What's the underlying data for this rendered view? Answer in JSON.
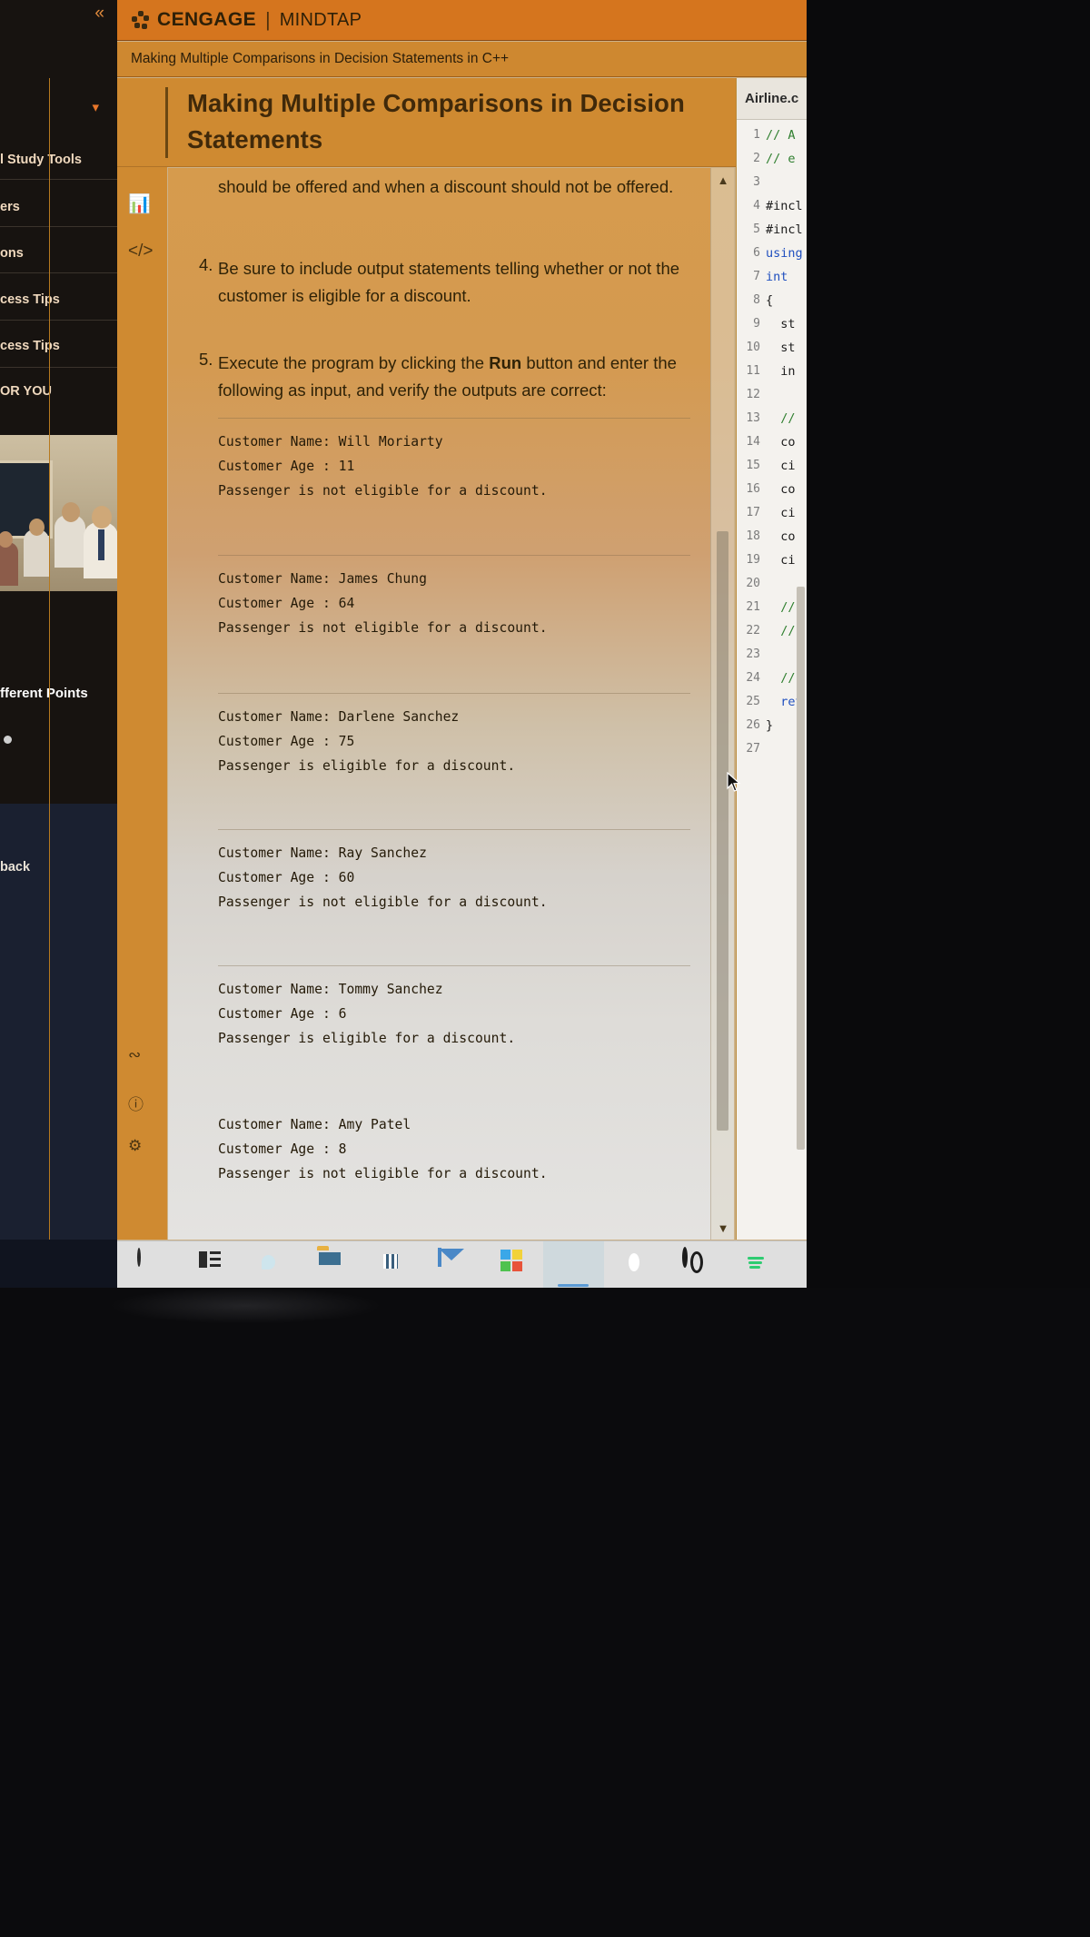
{
  "header": {
    "brand": "CENGAGE",
    "divider": "|",
    "product": "MINDTAP",
    "logo_icon": "cengage-leaf-icon"
  },
  "breadcrumb": {
    "text": "Making Multiple Comparisons in Decision Statements in C++"
  },
  "activity": {
    "book_icon": "open-book-icon",
    "title": "Making Multiple Comparisons in Decision Statements"
  },
  "icon_rail": [
    {
      "name": "open-book-icon",
      "glyph": "☷"
    },
    {
      "name": "checklist-icon",
      "glyph": "≣"
    },
    {
      "name": "bar-chart-icon",
      "glyph": "█"
    },
    {
      "name": "code-brackets-icon",
      "glyph": "</>"
    },
    {
      "name": "share-icon",
      "glyph": "∴"
    },
    {
      "name": "help-circle-icon",
      "glyph": "?"
    },
    {
      "name": "settings-gear-icon",
      "glyph": "⚙"
    }
  ],
  "sidebar": {
    "collapse_icon": "double-chevron-left-icon",
    "chevron_icon": "chevron-down-icon",
    "items": [
      {
        "label": "l Study Tools"
      },
      {
        "label": "ers"
      },
      {
        "label": "ons"
      },
      {
        "label": "cess Tips"
      },
      {
        "label": "cess Tips"
      },
      {
        "label": "OR YOU"
      }
    ],
    "promo_caption": "fferent Points",
    "back_label": "back"
  },
  "lesson": {
    "para_3_tail": "should be offered and when a discount should not be offered.",
    "items": [
      {
        "num": "4.",
        "text": "Be sure to include output statements telling whether or not the customer is eligible for a discount."
      },
      {
        "num": "5.",
        "text_before": "Execute the program by clicking the ",
        "bold": "Run",
        "text_after": " button and enter the following as input, and verify the outputs are correct:"
      }
    ],
    "outputs": [
      {
        "name_line": "Customer Name: Will Moriarty",
        "age_line": "Customer Age : 11",
        "result_line": "Passenger is not eligible for a discount."
      },
      {
        "name_line": "Customer Name: James Chung",
        "age_line": "Customer Age : 64",
        "result_line": "Passenger is not eligible for a discount."
      },
      {
        "name_line": "Customer Name: Darlene Sanchez",
        "age_line": "Customer Age : 75",
        "result_line": "Passenger is eligible for a discount."
      },
      {
        "name_line": "Customer Name: Ray Sanchez",
        "age_line": "Customer Age : 60",
        "result_line": "Passenger is not eligible for a discount."
      },
      {
        "name_line": "Customer Name: Tommy Sanchez",
        "age_line": "Customer Age : 6",
        "result_line": "Passenger is eligible for a discount."
      },
      {
        "name_line": "Customer Name: Amy Patel",
        "age_line": "Customer Age : 8",
        "result_line": "Passenger is not eligible for a discount."
      }
    ],
    "scrollbar": {
      "up_icon": "chevron-up-icon",
      "down_icon": "chevron-down-icon"
    }
  },
  "code_panel": {
    "tab_label": "Airline.c",
    "lines": [
      {
        "n": "1",
        "text": "// A",
        "kind": "cmt"
      },
      {
        "n": "2",
        "text": "// e",
        "kind": "cmt"
      },
      {
        "n": "3",
        "text": "",
        "kind": ""
      },
      {
        "n": "4",
        "text": "#incl",
        "kind": ""
      },
      {
        "n": "5",
        "text": "#incl",
        "kind": ""
      },
      {
        "n": "6",
        "text": "using",
        "kind": "kw"
      },
      {
        "n": "7",
        "text": "int ",
        "kind": "kw"
      },
      {
        "n": "8",
        "text": "{",
        "kind": ""
      },
      {
        "n": "9",
        "text": "  st",
        "kind": ""
      },
      {
        "n": "10",
        "text": "  st",
        "kind": ""
      },
      {
        "n": "11",
        "text": "  in",
        "kind": ""
      },
      {
        "n": "12",
        "text": "",
        "kind": ""
      },
      {
        "n": "13",
        "text": "  //",
        "kind": "cmt"
      },
      {
        "n": "14",
        "text": "  co",
        "kind": ""
      },
      {
        "n": "15",
        "text": "  ci",
        "kind": ""
      },
      {
        "n": "16",
        "text": "  co",
        "kind": ""
      },
      {
        "n": "17",
        "text": "  ci",
        "kind": ""
      },
      {
        "n": "18",
        "text": "  co",
        "kind": ""
      },
      {
        "n": "19",
        "text": "  ci",
        "kind": ""
      },
      {
        "n": "20",
        "text": "",
        "kind": ""
      },
      {
        "n": "21",
        "text": "  //",
        "kind": "cmt"
      },
      {
        "n": "22",
        "text": "  //",
        "kind": "cmt"
      },
      {
        "n": "23",
        "text": "",
        "kind": ""
      },
      {
        "n": "24",
        "text": "  //",
        "kind": "cmt"
      },
      {
        "n": "25",
        "text": "  ret",
        "kind": "kw"
      },
      {
        "n": "26",
        "text": "}",
        "kind": ""
      },
      {
        "n": "27",
        "text": "",
        "kind": ""
      }
    ]
  },
  "taskbar": [
    {
      "name": "start-cortana-icon",
      "cls": "ic-circle",
      "active": false
    },
    {
      "name": "task-view-icon",
      "cls": "ic-task",
      "active": false
    },
    {
      "name": "microsoft-edge-icon",
      "cls": "ic-edge",
      "active": false
    },
    {
      "name": "file-explorer-icon",
      "cls": "ic-folder",
      "active": false
    },
    {
      "name": "microsoft-store-icon",
      "cls": "ic-store",
      "active": false
    },
    {
      "name": "mail-icon",
      "cls": "ic-mail",
      "active": false
    },
    {
      "name": "photos-icon",
      "cls": "ic-photos",
      "active": false
    },
    {
      "name": "firefox-icon",
      "cls": "ic-fox",
      "active": true
    },
    {
      "name": "opera-icon",
      "cls": "ic-opera",
      "active": false
    },
    {
      "name": "opera-gx-icon",
      "cls": "ic-o2",
      "active": false
    },
    {
      "name": "spotify-icon",
      "cls": "ic-spot",
      "active": false
    }
  ],
  "colors": {
    "mindtap_orange": "#d5751e",
    "band_orange": "#cf8a31",
    "sidebar_dark": "#171310",
    "text_dark": "#2f2207",
    "accent_blue": "#2f6fb5"
  }
}
